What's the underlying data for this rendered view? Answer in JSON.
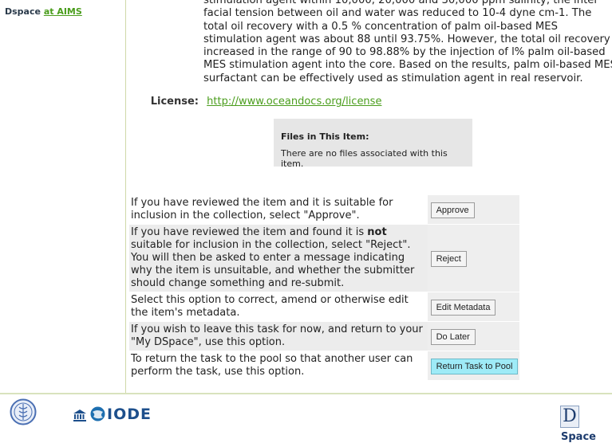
{
  "sidebar": {
    "prefix": "Dspace",
    "link": "at AIMS"
  },
  "abstract": {
    "text": "stimulation agent within 10,000, 20,000 and 30,000 ppm salinity, the inter facial tension between oil and water was reduced to 10-4 dyne cm-1. The total oil recovery with a 0.5 % concentration of palm oil-based MES stimulation agent was about 88 until 93.75%. However, the total oil recovery increased in the range of 90 to 98.88% by the injection of l% palm oil-based MES stimulation agent into the core. Based on the results, palm oil-based MES surfactant can be effectively used as stimulation agent in real reservoir."
  },
  "license": {
    "label": "License:",
    "url": "http://www.oceandocs.org/license"
  },
  "files": {
    "title": "Files in This Item:",
    "empty": "There are no files associated with this item."
  },
  "actions": [
    {
      "text": "If you have reviewed the item and it is suitable for inclusion in the collection, select \"Approve\".",
      "button": "Approve"
    },
    {
      "text_pre": "If you have reviewed the item and found it is ",
      "text_bold": "not",
      "text_post": " suitable for inclusion in the collection, select \"Reject\". You will then be asked to enter a message indicating why the item is unsuitable, and whether the submitter should change something and re-submit.",
      "button": "Reject"
    },
    {
      "text": "Select this option to correct, amend or otherwise edit the item's metadata.",
      "button": "Edit Metadata"
    },
    {
      "text": "If you wish to leave this task for now, and return to your \"My DSpace\", use this option.",
      "button": "Do Later"
    },
    {
      "text": "To return the task to the pool so that another user can perform the task, use this option.",
      "button": "Return Task to Pool"
    }
  ],
  "footer": {
    "iode": "IODE",
    "dspace_d": "D",
    "dspace_rest": "Space"
  },
  "colors": {
    "link": "#4a9d1c",
    "pool_button": "#9eebf7",
    "iode": "#1d4f8c"
  }
}
